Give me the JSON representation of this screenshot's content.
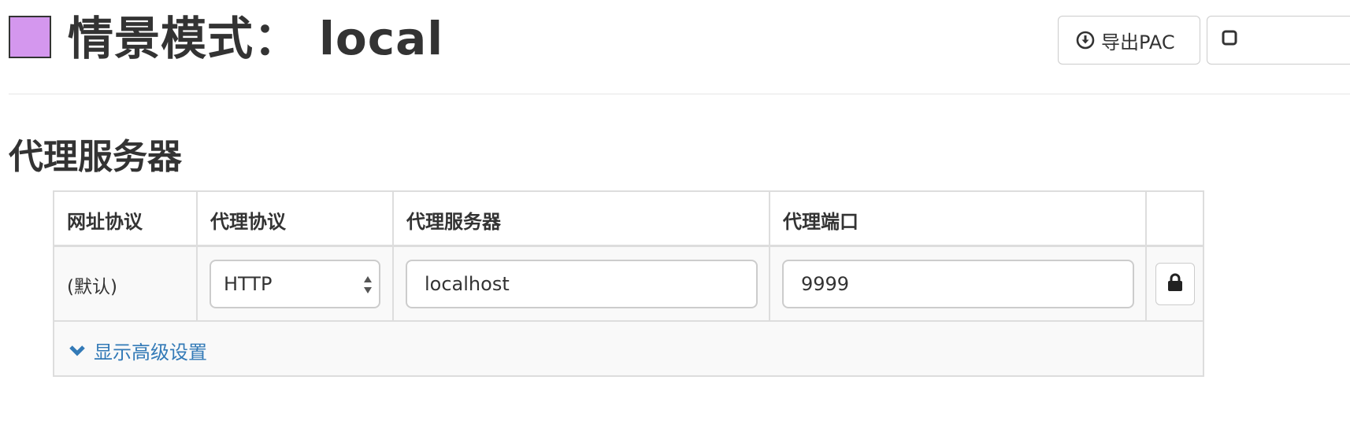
{
  "header": {
    "title_prefix": "情景模式：",
    "profile_name": "local",
    "profile_color": "#d497ee",
    "export_button_label": "导出PAC",
    "export_icon": "download-circle-icon"
  },
  "proxy_section": {
    "title": "代理服务器",
    "columns": [
      "网址协议",
      "代理协议",
      "代理服务器",
      "代理端口"
    ],
    "rows": [
      {
        "url_scheme": "(默认)",
        "protocol": "HTTP",
        "host": "localhost",
        "port": "9999",
        "lock_icon": "lock-icon"
      }
    ],
    "advanced_toggle_label": "显示高级设置",
    "advanced_icon": "chevron-down-icon",
    "link_color": "#337ab7"
  }
}
